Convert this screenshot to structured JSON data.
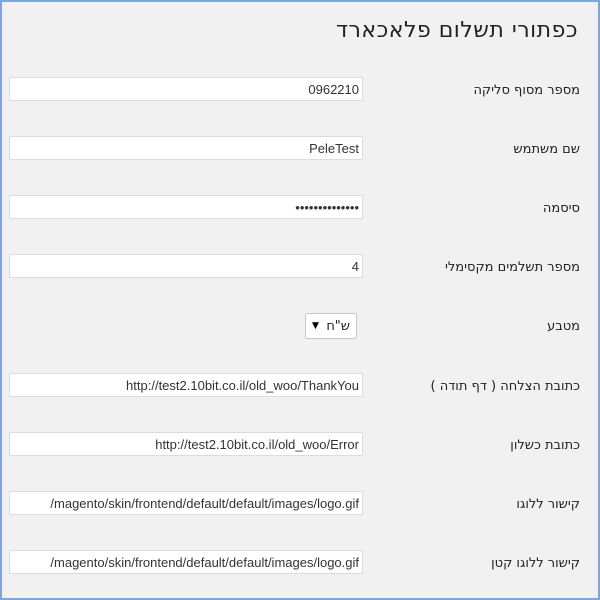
{
  "page": {
    "title": "כפתורי תשלום פלאכארד"
  },
  "fields": [
    {
      "label": "מספר מסוף סליקה",
      "value": "0962210"
    },
    {
      "label": "שם משתמש",
      "value": "PeleTest"
    },
    {
      "label": "סיסמה",
      "value": "••••••••••••••"
    },
    {
      "label": "מספר תשלמים מקסימלי",
      "value": "4"
    },
    {
      "label": "מטבע",
      "value": "ש\"ח"
    },
    {
      "label": "כתובת הצלחה ( דף תודה )",
      "value": "http://test2.10bit.co.il/old_woo/ThankYou"
    },
    {
      "label": "כתובת כשלון",
      "value": "http://test2.10bit.co.il/old_woo/Error"
    },
    {
      "label": "קישור ללוגו",
      "value": "/magento/skin/frontend/default/default/images/logo.gif"
    },
    {
      "label": "קישור ללוגו קטן",
      "value": "/magento/skin/frontend/default/default/images/logo.gif"
    }
  ],
  "icons": {
    "select_arrow": "▼"
  },
  "colors": {
    "frame_border": "#7fa6dd",
    "background": "#f1f1f1"
  }
}
